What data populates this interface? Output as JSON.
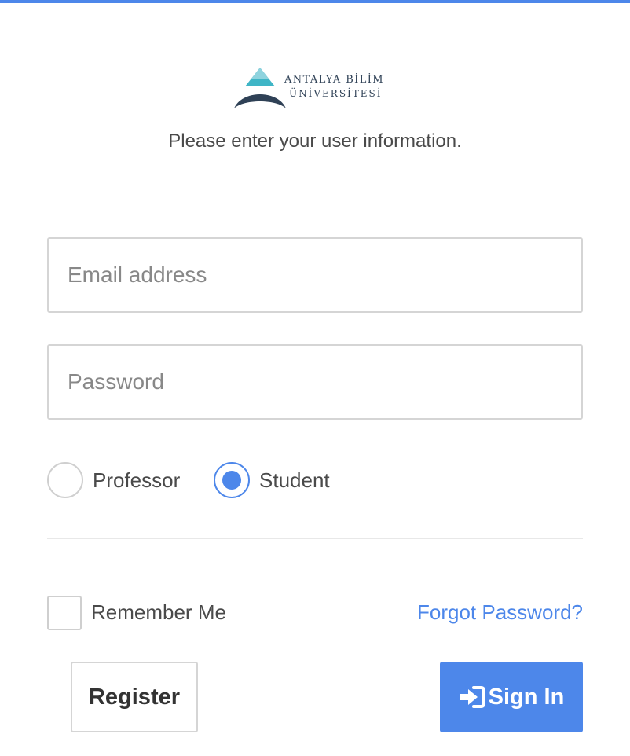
{
  "colors": {
    "accent": "#4d87ea",
    "border": "#d5d5d5",
    "text": "#4a4a4a",
    "logo_navy": "#2f4156",
    "logo_teal": "#3fb5c6"
  },
  "logo": {
    "line1": "ANTALYA BİLİM",
    "line2": "ÜNİVERSİTESİ",
    "icon": "antalya-bilim-logo-icon"
  },
  "subtitle": "Please enter your user information.",
  "form": {
    "email": {
      "value": "",
      "placeholder": "Email address"
    },
    "password": {
      "value": "",
      "placeholder": "Password"
    },
    "role_options": [
      {
        "label": "Professor",
        "selected": false
      },
      {
        "label": "Student",
        "selected": true
      }
    ],
    "remember_me_label": "Remember Me",
    "remember_me_checked": false,
    "forgot_password_label": "Forgot Password?"
  },
  "buttons": {
    "register_label": "Register",
    "signin_label": "Sign In",
    "signin_icon": "sign-in-icon"
  }
}
